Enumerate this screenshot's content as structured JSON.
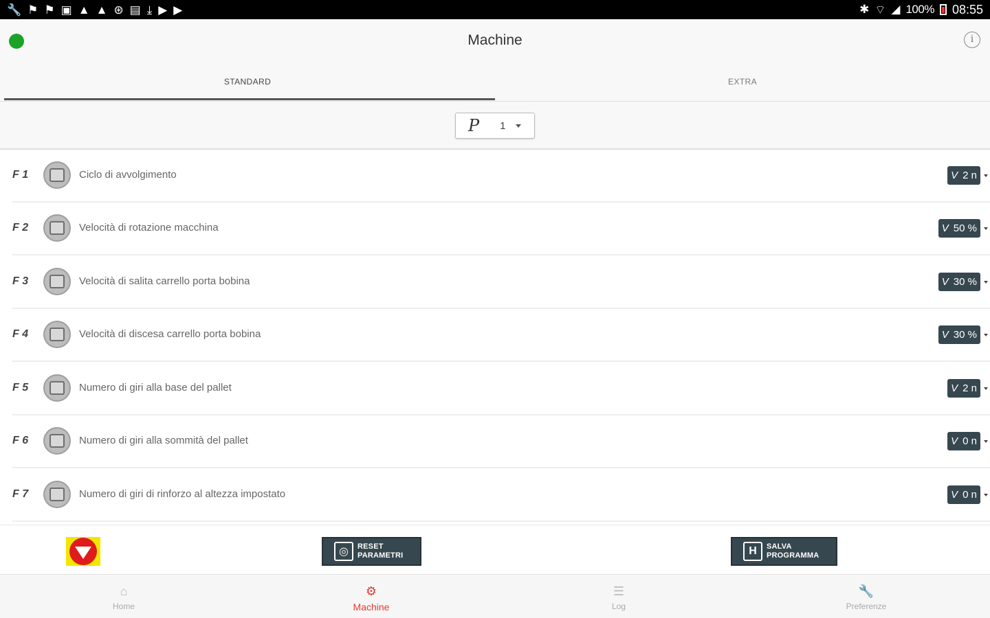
{
  "statusbar": {
    "left_icons": [
      "wrench-icon",
      "flag-icon",
      "flag-icon",
      "image-icon",
      "warning-icon",
      "warning-icon",
      "settings-icon",
      "sd-card-icon",
      "download-icon",
      "play-icon",
      "play-icon"
    ],
    "battery_percent": "100%",
    "time": "08:55"
  },
  "appbar": {
    "title": "Machine",
    "status_color": "#1aa328"
  },
  "tabs": [
    {
      "label": "STANDARD",
      "active": true
    },
    {
      "label": "EXTRA",
      "active": false
    }
  ],
  "program": {
    "prefix": "P",
    "number": "1"
  },
  "params": [
    {
      "code": "F 1",
      "label": "Ciclo di avvolgimento",
      "value_prefix": "V",
      "value": "2 n"
    },
    {
      "code": "F 2",
      "label": "Velocità di rotazione macchina",
      "value_prefix": "V",
      "value": "50 %"
    },
    {
      "code": "F 3",
      "label": "Velocità di salita carrello porta bobina",
      "value_prefix": "V",
      "value": "30 %"
    },
    {
      "code": "F 4",
      "label": "Velocità di discesa carrello porta bobina",
      "value_prefix": "V",
      "value": "30 %"
    },
    {
      "code": "F 5",
      "label": "Numero di giri alla base del pallet",
      "value_prefix": "V",
      "value": "2 n"
    },
    {
      "code": "F 6",
      "label": "Numero di giri alla sommità del pallet",
      "value_prefix": "V",
      "value": "0 n"
    },
    {
      "code": "F 7",
      "label": "Numero di giri di rinforzo al altezza impostato",
      "value_prefix": "V",
      "value": "0 n"
    }
  ],
  "actions": {
    "reset_label": "RESET PARAMETRI",
    "save_label": "SALVA PROGRAMMA",
    "save_icon_letter": "H",
    "estop_colors": {
      "background": "#f2e600",
      "button": "#e01b1b"
    }
  },
  "nav": [
    {
      "label": "Home",
      "icon": "home-icon",
      "glyph": "⌂",
      "active": false
    },
    {
      "label": "Machine",
      "icon": "gear-icon",
      "glyph": "⚙",
      "active": true
    },
    {
      "label": "Log",
      "icon": "log-icon",
      "glyph": "☰",
      "active": false
    },
    {
      "label": "Preferenze",
      "icon": "wrench-icon",
      "glyph": "🔧",
      "active": false
    }
  ],
  "colors": {
    "accent": "#e53935",
    "value_badge": "#37474f"
  }
}
